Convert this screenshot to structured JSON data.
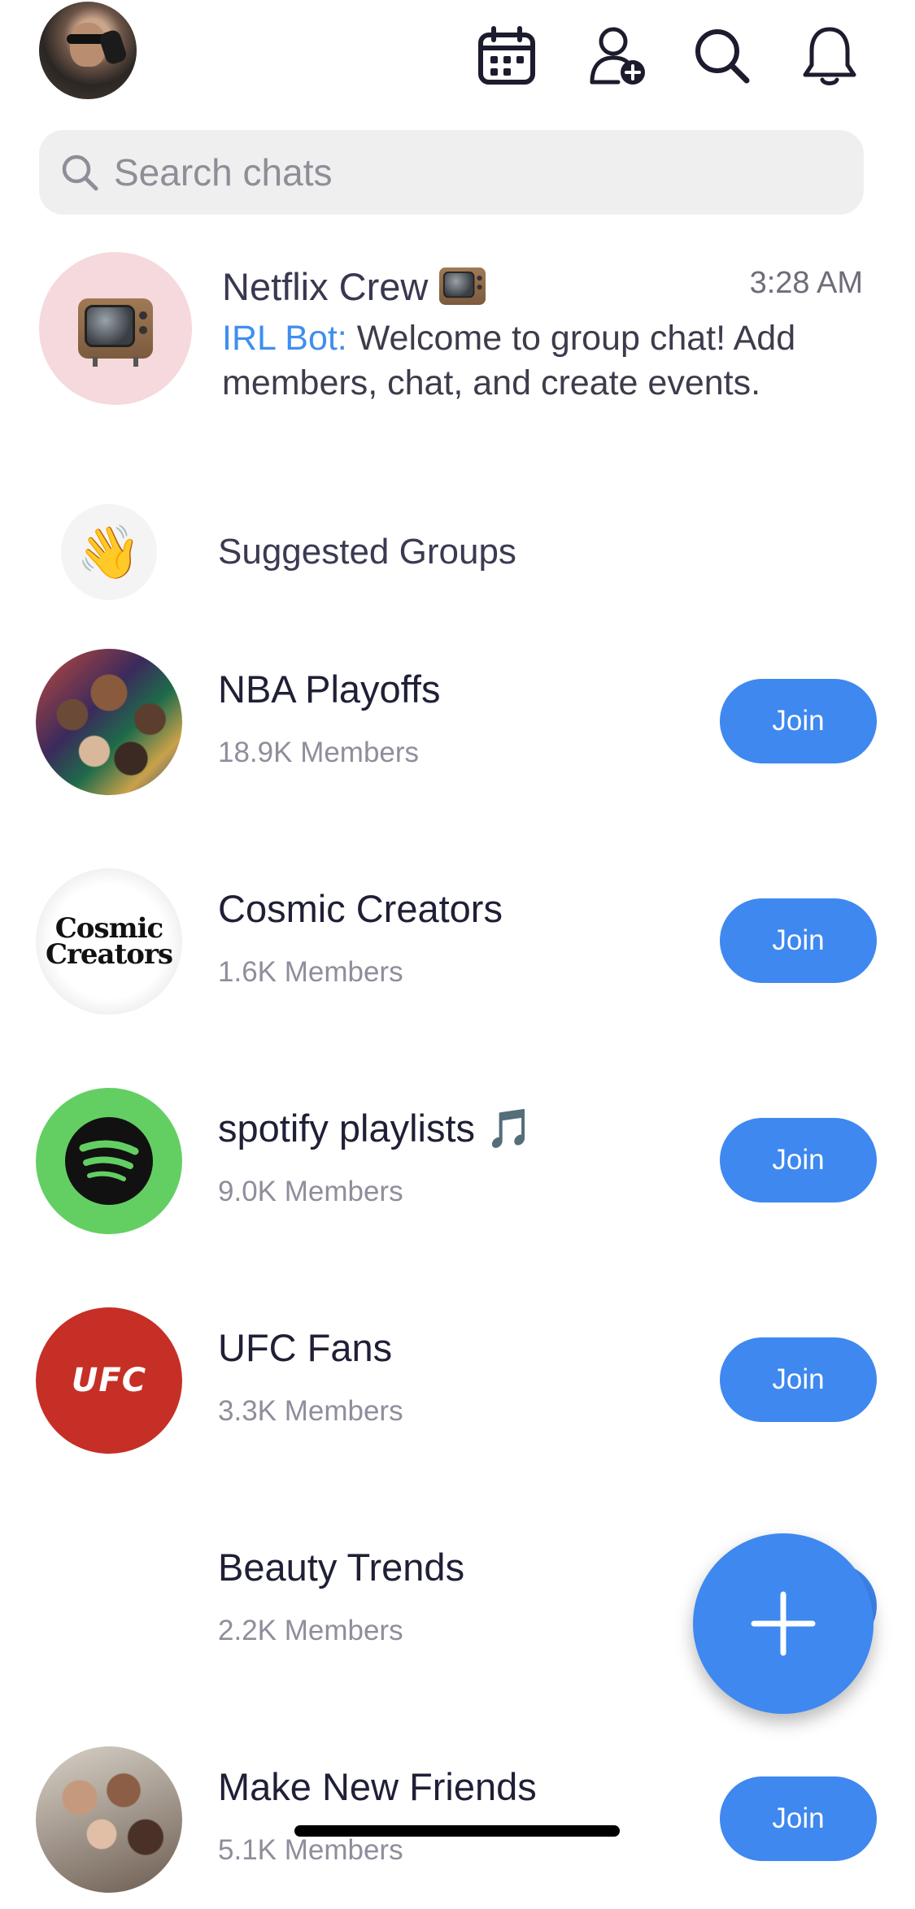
{
  "header": {
    "avatar_icon": "profile-avatar",
    "icons": [
      "calendar-icon",
      "add-friend-icon",
      "search-icon",
      "bell-icon"
    ]
  },
  "search": {
    "placeholder": "Search chats",
    "value": ""
  },
  "chat": {
    "name": "Netflix Crew",
    "emoji": "television",
    "time": "3:28 AM",
    "sender": "IRL Bot:",
    "message": "Welcome to group chat! Add members, chat, and create events."
  },
  "suggested": {
    "label": "Suggested Groups",
    "icon": "waving-hand-icon"
  },
  "groups": [
    {
      "name": "NBA Playoffs",
      "members": "18.9K Members",
      "join_label": "Join"
    },
    {
      "name": "Cosmic Creators",
      "members": "1.6K Members",
      "join_label": "Join",
      "avatar_text": [
        "Cosmic",
        "Creators"
      ]
    },
    {
      "name": "spotify playlists 🎵",
      "members": "9.0K Members",
      "join_label": "Join"
    },
    {
      "name": "UFC Fans",
      "members": "3.3K Members",
      "join_label": "Join",
      "avatar_text": "UFC"
    },
    {
      "name": "Beauty Trends",
      "members": "2.2K Members",
      "join_label": "Join"
    },
    {
      "name": "Make New Friends",
      "members": "5.1K Members",
      "join_label": "Join"
    }
  ],
  "colors": {
    "accent": "#3e88ef",
    "sender": "#3f8ef0",
    "spotify_green": "#63cf63",
    "ufc_red": "#c62f25",
    "chat_avatar_bg": "#f6d9dc"
  },
  "fab": {
    "icon": "plus-icon"
  }
}
